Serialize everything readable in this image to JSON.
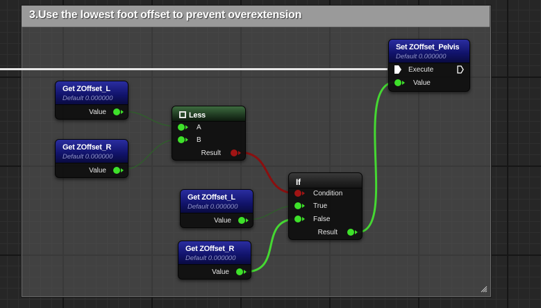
{
  "comment": {
    "title": "3.Use the lowest foot offset to prevent overextension"
  },
  "nodes": {
    "get_l_1": {
      "title": "Get ZOffset_L",
      "subtitle": "Default 0.000000",
      "out_label": "Value"
    },
    "get_r_1": {
      "title": "Get ZOffset_R",
      "subtitle": "Default 0.000000",
      "out_label": "Value"
    },
    "less": {
      "title": "Less",
      "in_a": "A",
      "in_b": "B",
      "out_label": "Result"
    },
    "if": {
      "title": "If",
      "in_condition": "Condition",
      "in_true": "True",
      "in_false": "False",
      "out_label": "Result"
    },
    "get_l_2": {
      "title": "Get ZOffset_L",
      "subtitle": "Default 0.000000",
      "out_label": "Value"
    },
    "get_r_2": {
      "title": "Get ZOffset_R",
      "subtitle": "Default 0.000000",
      "out_label": "Value"
    },
    "set_pelvis": {
      "title": "Set ZOffset_Pelvis",
      "subtitle": "Default 0.000000",
      "exec_label": "Execute",
      "in_label": "Value"
    }
  },
  "colors": {
    "float_pin": "#3ee12a",
    "bool_pin": "#a11414",
    "exec_wire": "#e6e6e6",
    "var_header": "#2a2da0",
    "pure_header": "#3d6b3f"
  }
}
